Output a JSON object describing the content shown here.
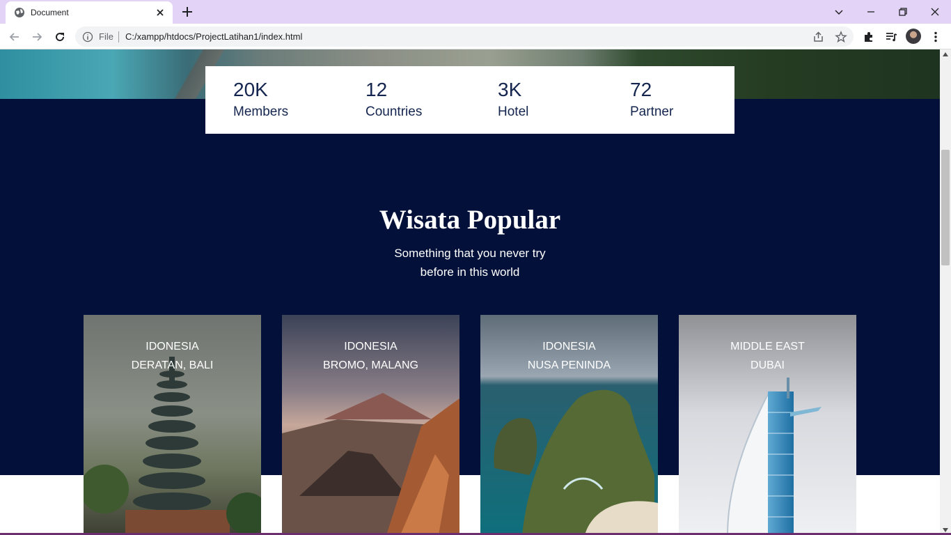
{
  "browser": {
    "tab_title": "Document",
    "omnibox_scheme": "File",
    "url": "C:/xampp/htdocs/ProjectLatihan1/index.html",
    "accent": "#e3d4f7"
  },
  "stats": [
    {
      "value": "20K",
      "label": "Members"
    },
    {
      "value": "12",
      "label": "Countries"
    },
    {
      "value": "3K",
      "label": "Hotel"
    },
    {
      "value": "72",
      "label": "Partner"
    }
  ],
  "section": {
    "title": "Wisata Popular",
    "subtitle_line1": "Something that you never try",
    "subtitle_line2": "before in this world"
  },
  "cards": [
    {
      "region": "IDONESIA",
      "place": "DERATAN, BALI"
    },
    {
      "region": "IDONESIA",
      "place": "BROMO, MALANG"
    },
    {
      "region": "IDONESIA",
      "place": "NUSA PENINDA"
    },
    {
      "region": "MIDDLE EAST",
      "place": "DUBAI"
    }
  ],
  "colors": {
    "dark_section": "#03113a",
    "stat_text": "#14254f",
    "card_accent": "#d98a3d"
  }
}
